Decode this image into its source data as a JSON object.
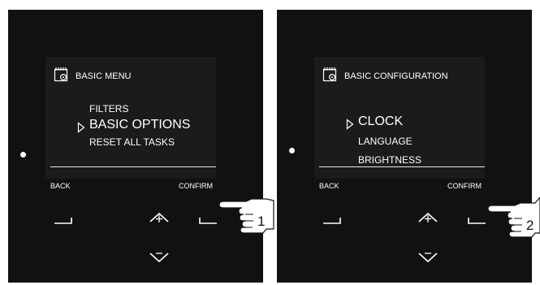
{
  "panels": [
    {
      "menu_title": "BASIC MENU",
      "items": [
        "FILTERS",
        "BASIC OPTIONS",
        "RESET ALL TASKS"
      ],
      "selected_index": 1,
      "soft_left": "BACK",
      "soft_right": "CONFIRM",
      "step_number": "1"
    },
    {
      "menu_title": "BASIC CONFIGURATION",
      "items": [
        "CLOCK",
        "LANGUAGE",
        "BRIGHTNESS"
      ],
      "selected_index": 0,
      "soft_left": "BACK",
      "soft_right": "CONFIRM",
      "step_number": "2"
    }
  ],
  "icons": {
    "menu_icon": "calendar-gear-icon",
    "cursor_icon": "triangle-cursor-icon",
    "up_button_icon": "chevron-up-plus-icon",
    "down_button_icon": "chevron-down-minus-icon",
    "left_softkey_icon": "softkey-bracket-left-icon",
    "right_softkey_icon": "softkey-bracket-right-icon",
    "hand_icon": "pointing-hand-icon",
    "status_light_icon": "status-dot-icon"
  },
  "colors": {
    "panel": "#111111",
    "screen": "#1b1b1b",
    "text": "#ffffff"
  }
}
